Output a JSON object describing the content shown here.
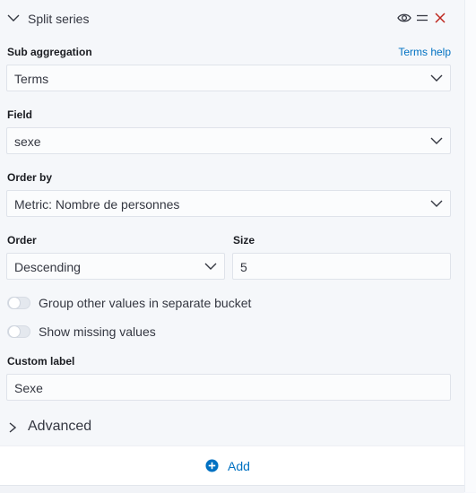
{
  "header": {
    "title": "Split series",
    "icons": [
      "chevron-down-icon",
      "eye-icon",
      "menu-icon",
      "close-icon"
    ]
  },
  "sub_aggregation": {
    "label": "Sub aggregation",
    "help_link": "Terms help",
    "value": "Terms"
  },
  "field": {
    "label": "Field",
    "value": "sexe"
  },
  "order_by": {
    "label": "Order by",
    "value": "Metric: Nombre de personnes"
  },
  "order": {
    "label": "Order",
    "value": "Descending"
  },
  "size": {
    "label": "Size",
    "value": "5"
  },
  "toggles": {
    "group_other": {
      "label": "Group other values in separate bucket",
      "checked": false
    },
    "show_missing": {
      "label": "Show missing values",
      "checked": false
    }
  },
  "custom_label": {
    "label": "Custom label",
    "value": "Sexe"
  },
  "advanced": {
    "label": "Advanced"
  },
  "footer": {
    "add_label": "Add"
  },
  "colors": {
    "accent": "#0071c2",
    "close": "#bd271e",
    "text": "#343741"
  }
}
